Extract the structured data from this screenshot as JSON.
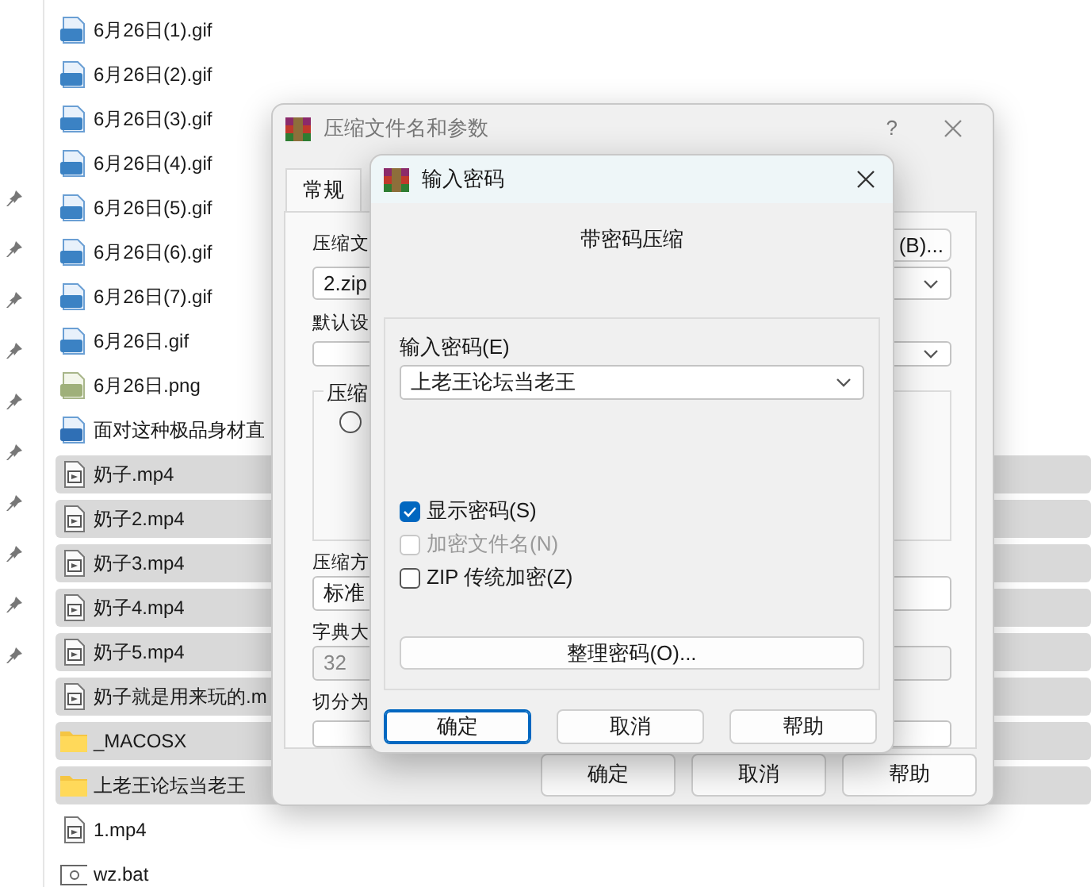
{
  "explorer": {
    "files": [
      {
        "name": "6月26日(1).gif",
        "kind": "gif",
        "selected": false
      },
      {
        "name": "6月26日(2).gif",
        "kind": "gif",
        "selected": false
      },
      {
        "name": "6月26日(3).gif",
        "kind": "gif",
        "selected": false
      },
      {
        "name": "6月26日(4).gif",
        "kind": "gif",
        "selected": false
      },
      {
        "name": "6月26日(5).gif",
        "kind": "gif",
        "selected": false
      },
      {
        "name": "6月26日(6).gif",
        "kind": "gif",
        "selected": false
      },
      {
        "name": "6月26日(7).gif",
        "kind": "gif",
        "selected": false
      },
      {
        "name": "6月26日.gif",
        "kind": "gif",
        "selected": false
      },
      {
        "name": "6月26日.png",
        "kind": "png",
        "selected": false
      },
      {
        "name": "面对这种极品身材直",
        "kind": "jpg",
        "selected": false
      },
      {
        "name": "奶子.mp4",
        "kind": "video",
        "selected": true
      },
      {
        "name": "奶子2.mp4",
        "kind": "video",
        "selected": true
      },
      {
        "name": "奶子3.mp4",
        "kind": "video",
        "selected": true
      },
      {
        "name": "奶子4.mp4",
        "kind": "video",
        "selected": true
      },
      {
        "name": "奶子5.mp4",
        "kind": "video",
        "selected": true
      },
      {
        "name": "奶子就是用来玩的.m",
        "kind": "video",
        "selected": true
      },
      {
        "name": "_MACOSX",
        "kind": "folder",
        "selected": true
      },
      {
        "name": "上老王论坛当老王",
        "kind": "folder",
        "selected": true
      },
      {
        "name": "1.mp4",
        "kind": "video",
        "selected": false
      },
      {
        "name": "wz.bat",
        "kind": "bat",
        "selected": false
      }
    ]
  },
  "archive_dialog": {
    "title": "压缩文件名和参数",
    "help": "?",
    "tabs": [
      {
        "label": "常规",
        "selected": true
      }
    ],
    "archive_name_label": "压缩文",
    "browse_button": "(B)...",
    "archive_name": "2.zip",
    "profile_label": "默认设",
    "group_label": "压缩",
    "radio": {
      "selected": false
    },
    "method_label": "压缩方",
    "method": "标准",
    "dictionary_label": "字典大",
    "dictionary": "32",
    "split_label": "切分为",
    "buttons": [
      "确定",
      "取消",
      "帮助"
    ]
  },
  "password_dialog": {
    "title": "输入密码",
    "heading": "带密码压缩",
    "password_label": "输入密码(E)",
    "password": "上老王论坛当老王",
    "options": [
      {
        "label": "显示密码(S)",
        "checked": true,
        "disabled": false
      },
      {
        "label": "加密文件名(N)",
        "checked": false,
        "disabled": true
      },
      {
        "label": "ZIP 传统加密(Z)",
        "checked": false,
        "disabled": false
      }
    ],
    "organize_button": "整理密码(O)...",
    "buttons": [
      {
        "label": "确定",
        "default": true
      },
      {
        "label": "取消",
        "default": false
      },
      {
        "label": "帮助",
        "default": false
      }
    ]
  }
}
